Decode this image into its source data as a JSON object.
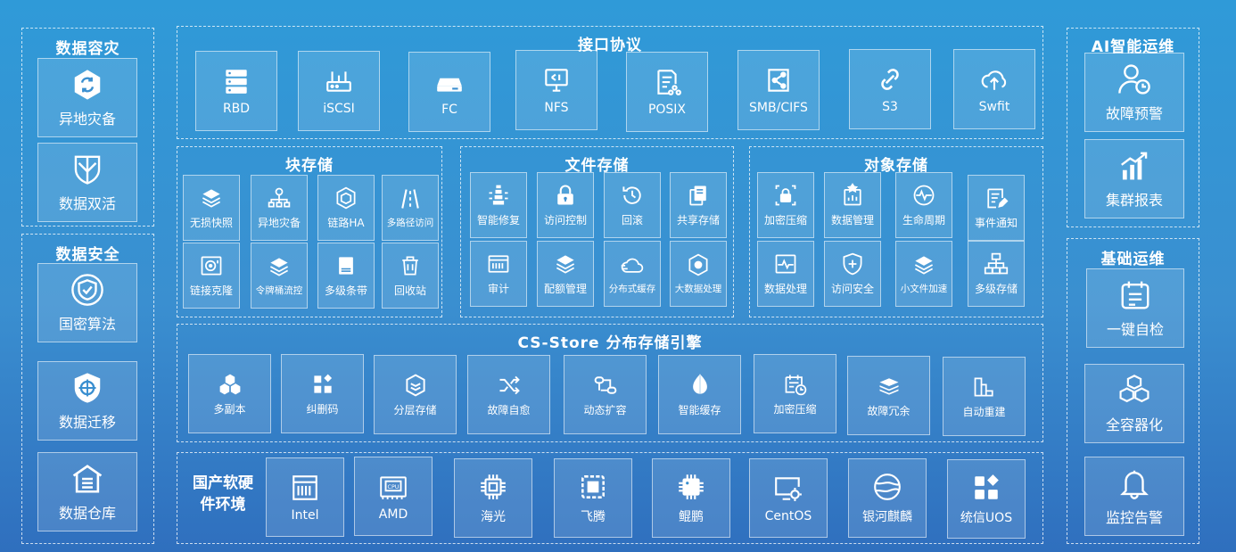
{
  "colors": {
    "background_top": "#2f9ad8",
    "background_bottom": "#2f6fbe",
    "tile_border": "#ffffff"
  },
  "disaster_recovery": {
    "title": "数据容灾",
    "items": [
      {
        "label": "异地灾备",
        "icon": "sync-hexagon-icon"
      },
      {
        "label": "数据双活",
        "icon": "shield-split-icon"
      }
    ]
  },
  "data_security": {
    "title": "数据安全",
    "items": [
      {
        "label": "国密算法",
        "icon": "shield-check-icon"
      },
      {
        "label": "数据迁移",
        "icon": "shield-target-icon"
      },
      {
        "label": "数据仓库",
        "icon": "warehouse-icon"
      }
    ]
  },
  "protocols": {
    "title": "接口协议",
    "items": [
      {
        "label": "RBD",
        "icon": "server-rack-icon"
      },
      {
        "label": "iSCSI",
        "icon": "router-icon"
      },
      {
        "label": "FC",
        "icon": "hard-drive-icon"
      },
      {
        "label": "NFS",
        "icon": "monitor-share-icon"
      },
      {
        "label": "POSIX",
        "icon": "document-share-icon"
      },
      {
        "label": "SMB/CIFS",
        "icon": "share-box-icon"
      },
      {
        "label": "S3",
        "icon": "link-chain-icon"
      },
      {
        "label": "Swfit",
        "icon": "cloud-upload-icon"
      }
    ]
  },
  "block_storage": {
    "title": "块存储",
    "items": [
      {
        "label": "无损快照",
        "icon": "layers-cloud-icon"
      },
      {
        "label": "异地灾备",
        "icon": "network-gear-icon"
      },
      {
        "label": "链路HA",
        "icon": "cube-icon"
      },
      {
        "label": "多路径访问",
        "icon": "road-icon"
      },
      {
        "label": "链接克隆",
        "icon": "disk-clone-icon"
      },
      {
        "label": "令牌桶流控",
        "icon": "layers-cloud-icon"
      },
      {
        "label": "多级条带",
        "icon": "stripe-icon"
      },
      {
        "label": "回收站",
        "icon": "trash-icon"
      }
    ]
  },
  "file_storage": {
    "title": "文件存储",
    "items": [
      {
        "label": "智能修复",
        "icon": "repair-icon"
      },
      {
        "label": "访问控制",
        "icon": "lock-icon"
      },
      {
        "label": "回滚",
        "icon": "history-icon"
      },
      {
        "label": "共享存储",
        "icon": "copy-file-icon"
      },
      {
        "label": "审计",
        "icon": "audit-icon"
      },
      {
        "label": "配额管理",
        "icon": "layers-cloud-icon"
      },
      {
        "label": "分布式缓存",
        "icon": "cloud-icon"
      },
      {
        "label": "大数据处理",
        "icon": "hex-gear-icon"
      }
    ]
  },
  "object_storage": {
    "title": "对象存储",
    "items": [
      {
        "label": "加密压缩",
        "icon": "lock-box-icon"
      },
      {
        "label": "数据管理",
        "icon": "chart-badge-icon"
      },
      {
        "label": "生命周期",
        "icon": "pulse-circle-icon"
      },
      {
        "label": "事件通知",
        "icon": "edit-doc-icon"
      },
      {
        "label": "数据处理",
        "icon": "pulse-square-icon"
      },
      {
        "label": "访问安全",
        "icon": "shield-plus-icon"
      },
      {
        "label": "小文件加速",
        "icon": "layers-cloud-icon"
      },
      {
        "label": "多级存储",
        "icon": "hierarchy-icon"
      }
    ]
  },
  "engine": {
    "title": "CS-Store 分布存储引擎",
    "items": [
      {
        "label": "多副本",
        "icon": "hex-cluster-icon"
      },
      {
        "label": "纠删码",
        "icon": "blocks-icon"
      },
      {
        "label": "分层存储",
        "icon": "hex-layers-icon"
      },
      {
        "label": "故障自愈",
        "icon": "shuffle-icon"
      },
      {
        "label": "动态扩容",
        "icon": "expand-icon"
      },
      {
        "label": "智能缓存",
        "icon": "leaf-drop-icon"
      },
      {
        "label": "加密压缩",
        "icon": "calendar-clock-icon"
      },
      {
        "label": "故障冗余",
        "icon": "stack-icon"
      },
      {
        "label": "自动重建",
        "icon": "rebuild-icon"
      }
    ]
  },
  "hardware": {
    "title_line1": "国产软硬",
    "title_line2": "件环境",
    "items": [
      {
        "label": "Intel",
        "icon": "server-icon"
      },
      {
        "label": "AMD",
        "icon": "cpu-icon"
      },
      {
        "label": "海光",
        "icon": "chip-icon"
      },
      {
        "label": "飞腾",
        "icon": "chip-square-icon"
      },
      {
        "label": "鲲鹏",
        "icon": "chip-solid-icon"
      },
      {
        "label": "CentOS",
        "icon": "monitor-gear-icon"
      },
      {
        "label": "银河麒麟",
        "icon": "globe-icon"
      },
      {
        "label": "统信UOS",
        "icon": "apps-icon"
      }
    ]
  },
  "ai_ops": {
    "title": "AI智能运维",
    "items": [
      {
        "label": "故障预警",
        "icon": "user-clock-icon"
      },
      {
        "label": "集群报表",
        "icon": "bar-trend-icon"
      }
    ]
  },
  "basic_ops": {
    "title": "基础运维",
    "items": [
      {
        "label": "一键自检",
        "icon": "checklist-icon"
      },
      {
        "label": "全容器化",
        "icon": "cubes-icon"
      },
      {
        "label": "监控告警",
        "icon": "bell-icon"
      }
    ]
  }
}
